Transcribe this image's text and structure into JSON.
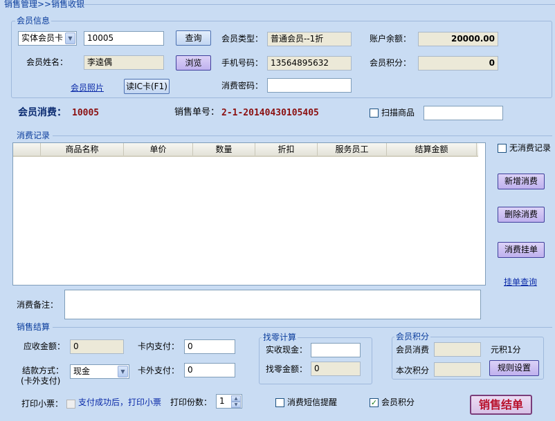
{
  "breadcrumb": "销售管理>>销售收银",
  "member_info": {
    "legend": "会员信息",
    "card_type_selected": "实体会员卡",
    "card_no": "10005",
    "query_label": "查询",
    "member_type_label": "会员类型：",
    "member_type_value": "普通会员--1折",
    "balance_label": "账户余额：",
    "balance_value": "20000.00",
    "name_label": "会员姓名：",
    "name_value": "李逵偶",
    "browse_label": "浏览",
    "phone_label": "手机号码：",
    "phone_value": "13564895632",
    "points_label": "会员积分：",
    "points_value": "0",
    "photo_link": "会员照片",
    "read_ic_label": "读IC卡(F1)",
    "password_label": "消费密码：",
    "password_value": ""
  },
  "consume_bar": {
    "member_consume_label": "会员消费：",
    "member_consume_value": "10005",
    "order_no_label": "销售单号：",
    "order_no_value": "2-1-20140430105405",
    "scan_label": "扫描商品",
    "scan_value": ""
  },
  "records": {
    "legend": "消费记录",
    "columns": [
      "商品名称",
      "单价",
      "数量",
      "折扣",
      "服务员工",
      "结算金额"
    ],
    "no_consume_label": "无消费记录",
    "add_label": "新增消费",
    "delete_label": "删除消费",
    "hold_label": "消费挂单",
    "hold_query_link": "挂单查询",
    "remark_label": "消费备注："
  },
  "settlement": {
    "legend": "销售结算",
    "receivable_label": "应收金额：",
    "receivable_value": "0",
    "card_pay_label": "卡内支付：",
    "card_pay_value": "0",
    "pay_method_label": "结款方式：",
    "pay_method_sub": "(卡外支付)",
    "pay_method_value": "现金",
    "outside_pay_label": "卡外支付：",
    "outside_pay_value": "0"
  },
  "change": {
    "legend": "找零计算",
    "cash_label": "实收现金：",
    "cash_value": "",
    "change_label": "找零金额：",
    "change_value": "0"
  },
  "member_points": {
    "legend": "会员积分",
    "consume_label": "会员消费",
    "consume_value": "",
    "rate_label": "元积1分",
    "this_points_label": "本次积分",
    "this_points_value": "",
    "rules_label": "规则设置"
  },
  "footer": {
    "print_label": "打印小票：",
    "print_after_label": "支付成功后，打印小票",
    "copies_label": "打印份数：",
    "copies_value": "1",
    "sms_label": "消费短信提醒",
    "points_label": "会员积分",
    "checkout_label": "销售结单"
  }
}
